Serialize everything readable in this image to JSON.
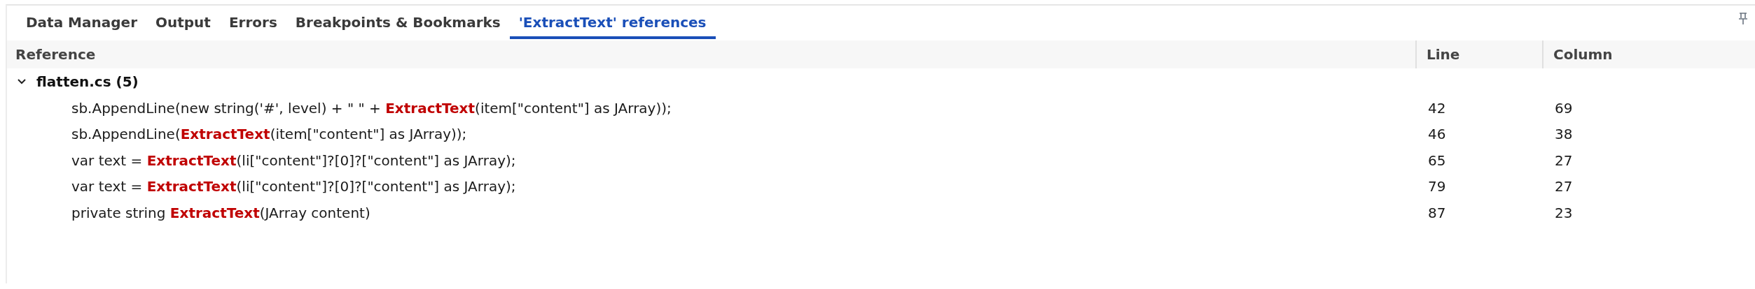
{
  "tabs": [
    {
      "label": "Data Manager",
      "selected": false
    },
    {
      "label": "Output",
      "selected": false
    },
    {
      "label": "Errors",
      "selected": false
    },
    {
      "label": "Breakpoints & Bookmarks",
      "selected": false
    },
    {
      "label": "'ExtractText' references",
      "selected": true
    }
  ],
  "table": {
    "columns": [
      "Reference",
      "Line",
      "Column"
    ],
    "groups": [
      {
        "label": "flatten.cs (5)",
        "expanded": true,
        "rows": [
          {
            "reference": "sb.AppendLine(new string('#', level) + \" \" + **ExtractText**(item[\"content\"] as JArray));",
            "line": "42",
            "column": "69"
          },
          {
            "reference": "sb.AppendLine(**ExtractText**(item[\"content\"] as JArray));",
            "line": "46",
            "column": "38"
          },
          {
            "reference": "var text = **ExtractText**(li[\"content\"]?[0]?[\"content\"] as JArray);",
            "line": "65",
            "column": "27"
          },
          {
            "reference": "var text = **ExtractText**(li[\"content\"]?[0]?[\"content\"] as JArray);",
            "line": "79",
            "column": "27"
          },
          {
            "reference": "private string **ExtractText**(JArray content)",
            "line": "87",
            "column": "23"
          }
        ]
      }
    ]
  }
}
